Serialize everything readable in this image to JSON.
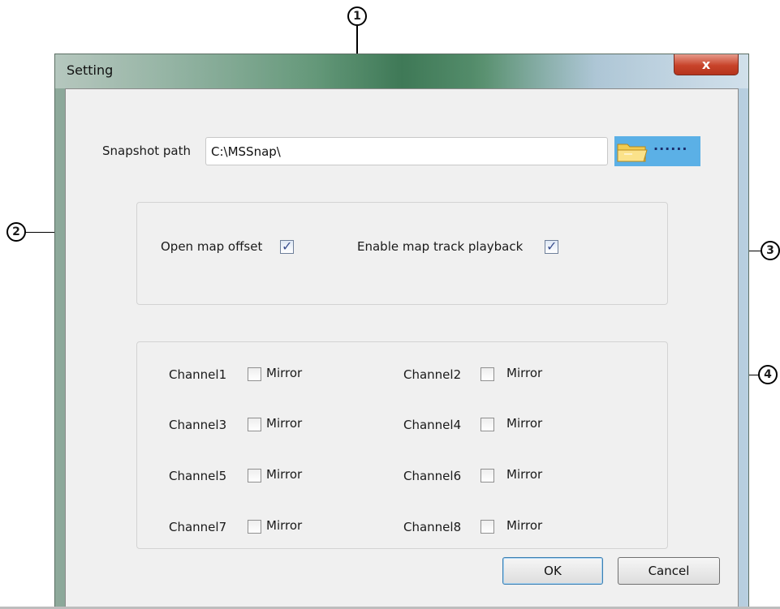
{
  "window": {
    "title": "Setting",
    "close_label": "x"
  },
  "snapshot": {
    "label": "Snapshot path",
    "value": "C:\\MSSnap\\",
    "browse_dots": "......"
  },
  "options": {
    "map_offset_label": "Open map offset",
    "map_offset_checked": true,
    "track_playback_label": "Enable map track playback",
    "track_playback_checked": true
  },
  "channels": [
    {
      "label": "Channel1",
      "mirror_label": "Mirror",
      "checked": false
    },
    {
      "label": "Channel2",
      "mirror_label": "Mirror",
      "checked": false
    },
    {
      "label": "Channel3",
      "mirror_label": "Mirror",
      "checked": false
    },
    {
      "label": "Channel4",
      "mirror_label": "Mirror",
      "checked": false
    },
    {
      "label": "Channel5",
      "mirror_label": "Mirror",
      "checked": false
    },
    {
      "label": "Channel6",
      "mirror_label": "Mirror",
      "checked": false
    },
    {
      "label": "Channel7",
      "mirror_label": "Mirror",
      "checked": false
    },
    {
      "label": "Channel8",
      "mirror_label": "Mirror",
      "checked": false
    }
  ],
  "buttons": {
    "ok": "OK",
    "cancel": "Cancel"
  },
  "callouts": [
    "1",
    "2",
    "3",
    "4"
  ],
  "colors": {
    "close": "#c8432a",
    "browse": "#5bb0e6",
    "client": "#f0f0f0"
  },
  "icons": {
    "browse": "folder-icon",
    "check": "checkmark-icon"
  }
}
